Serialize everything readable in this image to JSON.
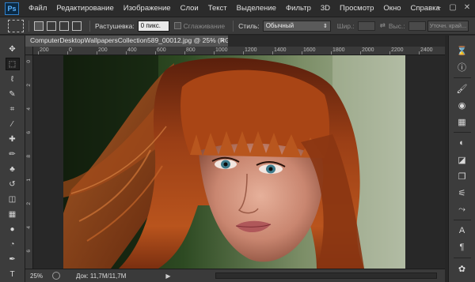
{
  "app": {
    "logo": "Ps"
  },
  "menu": [
    "Файл",
    "Редактирование",
    "Изображение",
    "Слои",
    "Текст",
    "Выделение",
    "Фильтр",
    "3D",
    "Просмотр",
    "Окно",
    "Справка"
  ],
  "window_controls": {
    "minimize": "–",
    "restore": "▢",
    "close": "✕"
  },
  "options": {
    "feather_label": "Растушевка:",
    "feather_value": "0 пикс.",
    "antialias_label": "Сглаживание",
    "style_label": "Стиль:",
    "style_value": "Обычный",
    "width_label": "Шир.:",
    "height_label": "Выс.:",
    "refine_edge_label": "Уточн. край..."
  },
  "document": {
    "tab_title": "ComputerDesktopWallpapersCollection589_00012.jpg @ 25% (RGB/8#)",
    "close_symbol": "×"
  },
  "ruler": {
    "h_ticks": [
      "200",
      "0",
      "200",
      "400",
      "600",
      "800",
      "1000",
      "1200",
      "1400",
      "1600",
      "1800",
      "2000",
      "2200",
      "2400"
    ],
    "v_ticks": [
      "0",
      "2",
      "4",
      "6",
      "8",
      "1",
      "2",
      "4",
      "6"
    ]
  },
  "status": {
    "zoom": "25%",
    "doc_info": "Док: 11,7M/11,7M",
    "arrow": "▶"
  },
  "tools": [
    {
      "name": "move-tool-icon",
      "glyph": "✥",
      "selected": false
    },
    {
      "name": "marquee-tool-icon",
      "glyph": "⬚",
      "selected": true
    },
    {
      "name": "lasso-tool-icon",
      "glyph": "ℓ",
      "selected": false
    },
    {
      "name": "quick-select-tool-icon",
      "glyph": "✎",
      "selected": false
    },
    {
      "name": "crop-tool-icon",
      "glyph": "⌗",
      "selected": false
    },
    {
      "name": "eyedropper-tool-icon",
      "glyph": "⁄",
      "selected": false
    },
    {
      "name": "healing-brush-tool-icon",
      "glyph": "✚",
      "selected": false
    },
    {
      "name": "brush-tool-icon",
      "glyph": "✏",
      "selected": false
    },
    {
      "name": "clone-stamp-tool-icon",
      "glyph": "♣",
      "selected": false
    },
    {
      "name": "history-brush-tool-icon",
      "glyph": "↺",
      "selected": false
    },
    {
      "name": "eraser-tool-icon",
      "glyph": "◫",
      "selected": false
    },
    {
      "name": "gradient-tool-icon",
      "glyph": "▦",
      "selected": false
    },
    {
      "name": "blur-tool-icon",
      "glyph": "●",
      "selected": false
    },
    {
      "name": "dodge-tool-icon",
      "glyph": "◔",
      "selected": false
    },
    {
      "name": "pen-tool-icon",
      "glyph": "✒",
      "selected": false
    },
    {
      "name": "type-tool-icon",
      "glyph": "T",
      "selected": false
    },
    {
      "name": "path-select-tool-icon",
      "glyph": "➤",
      "selected": false
    }
  ],
  "panel_icons": [
    {
      "name": "history-panel-icon",
      "glyph": "⌛"
    },
    {
      "name": "info-panel-icon",
      "glyph": "ⓘ"
    },
    {
      "name": "brush-panel-icon",
      "glyph": "🖌"
    },
    {
      "name": "swatches-panel-icon",
      "glyph": "◉"
    },
    {
      "name": "styles-panel-icon",
      "glyph": "▦"
    },
    {
      "name": "adjustments-panel-icon",
      "glyph": "◐"
    },
    {
      "name": "properties-panel-icon",
      "glyph": "◪"
    },
    {
      "name": "layers-panel-icon",
      "glyph": "❐"
    },
    {
      "name": "channels-panel-icon",
      "glyph": "⚟"
    },
    {
      "name": "paths-panel-icon",
      "glyph": "⤳"
    },
    {
      "name": "character-panel-icon",
      "glyph": "A"
    },
    {
      "name": "paragraph-panel-icon",
      "glyph": "¶"
    },
    {
      "name": "3d-panel-icon",
      "glyph": "✿"
    },
    {
      "name": "notes-panel-icon",
      "glyph": "▣"
    }
  ]
}
